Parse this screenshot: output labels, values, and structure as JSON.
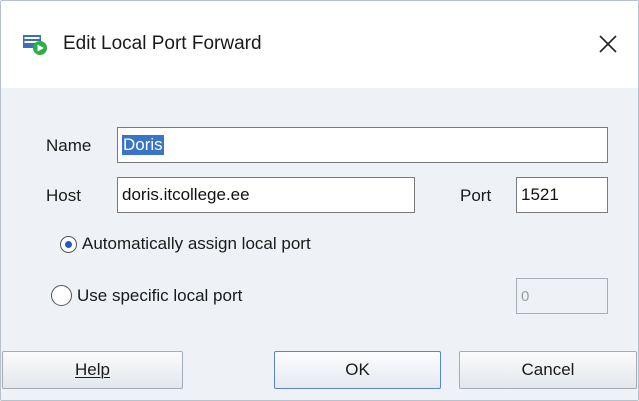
{
  "window": {
    "title": "Edit Local Port Forward",
    "icon": "port-forward-app-icon",
    "close_glyph": "✕"
  },
  "form": {
    "name_label": "Name",
    "name_value": "Doris",
    "host_label": "Host",
    "host_value": "doris.itcollege.ee",
    "port_label": "Port",
    "port_value": "1521",
    "radio_auto_label": "Automatically assign local port",
    "radio_auto_checked": true,
    "radio_specific_label": "Use specific local port",
    "radio_specific_checked": false,
    "specific_port_value": "0"
  },
  "buttons": {
    "help_label": "Help",
    "ok_label": "OK",
    "cancel_label": "Cancel"
  },
  "colors": {
    "dialog_bg": "#eef1f6",
    "selection": "#3a74c9",
    "radio_dot": "#1e5cc9",
    "icon_green": "#2eae4a",
    "icon_blue": "#3b6fb6"
  }
}
